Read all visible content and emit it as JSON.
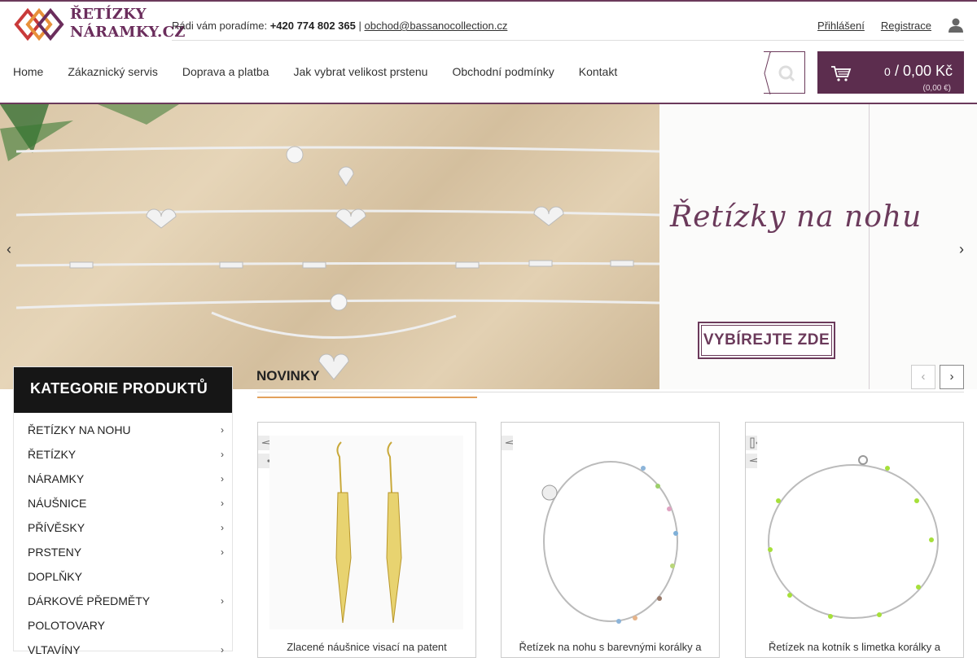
{
  "header": {
    "logo_line1": "ŘETÍZKY",
    "logo_line2": "NÁRAMKY.CZ",
    "contact_label": "Rádi vám poradíme:",
    "phone": "+420 774 802 365",
    "separator": "|",
    "email": "obchod@bassanocollection.cz",
    "login": "Přihlášení",
    "register": "Registrace"
  },
  "nav": {
    "items": [
      "Home",
      "Zákaznický servis",
      "Doprava a platba",
      "Jak vybrat velikost prstenu",
      "Obchodní podmínky",
      "Kontakt"
    ]
  },
  "cart": {
    "count": "0",
    "total": "/ 0,00 Kč",
    "total_eur": "(0,00 €)"
  },
  "banner": {
    "headline": "Řetízky na nohu",
    "button": "VYBÍREJTE ZDE"
  },
  "sidebar": {
    "title": "KATEGORIE PRODUKTŮ",
    "items": [
      {
        "label": "ŘETÍZKY NA NOHU",
        "chevron": "›"
      },
      {
        "label": "ŘETÍZKY",
        "chevron": "›"
      },
      {
        "label": "NÁRAMKY",
        "chevron": "›"
      },
      {
        "label": "NÁUŠNICE",
        "chevron": "›"
      },
      {
        "label": "PŘÍVĚSKY",
        "chevron": "›"
      },
      {
        "label": "PRSTENY",
        "chevron": "›"
      },
      {
        "label": "DOPLŇKY",
        "chevron": ""
      },
      {
        "label": "DÁRKOVÉ PŘEDMĚTY",
        "chevron": "›"
      },
      {
        "label": "POLOTOVARY",
        "chevron": ""
      },
      {
        "label": "VLTAVÍNY",
        "chevron": "›"
      }
    ]
  },
  "section": {
    "title": "NOVINKY",
    "prev": "‹",
    "next": "›"
  },
  "products": [
    {
      "name": "Zlacené náušnice visací na patent",
      "badges": [
        "paper-plane-icon",
        "dot-icon"
      ]
    },
    {
      "name": "Řetízek na nohu s barevnými korálky a",
      "badges": [
        "paper-plane-icon"
      ]
    },
    {
      "name": "Řetízek na kotník s limetka korálky a",
      "badges": [
        "back-arrow-icon",
        "paper-plane-icon"
      ]
    }
  ],
  "colors": {
    "brand": "#6b3a5b",
    "cart_bg": "#5c2d4e",
    "accent": "#e2a15c",
    "sidebar_head": "#161616"
  }
}
